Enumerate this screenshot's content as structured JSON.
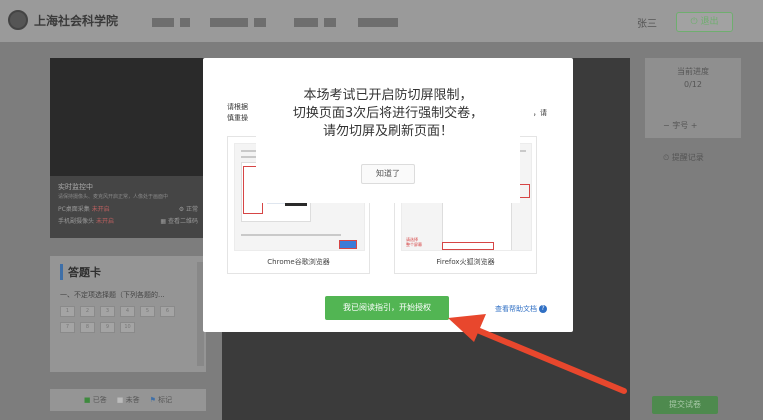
{
  "header": {
    "logo_text": "上海社会科学院",
    "user_name": "张三",
    "logout_label": "退出"
  },
  "monitor": {
    "title": "实时监控中",
    "description": "请保持摄像头、麦克风开启正常，人像处于画面中",
    "pc_label": "PC桌面采集",
    "pc_status": "未开启",
    "pc_status_right": "正常",
    "phone_label": "手机副摄像头",
    "phone_status": "未开启",
    "phone_status_right": "查看二维码"
  },
  "answer_card": {
    "title": "答题卡",
    "section": "一、不定项选择题（下列各题的...",
    "questions": [
      "1",
      "2",
      "3",
      "4",
      "5",
      "6",
      "7",
      "8",
      "9",
      "10"
    ],
    "legend": [
      "已答",
      "未答",
      "标记"
    ]
  },
  "right_panel": {
    "progress_label": "当前进度",
    "progress_value": "0/12",
    "font_size_label": "字号",
    "prompt_record_label": "提醒记录",
    "submit_label": "提交试卷"
  },
  "modal": {
    "intro_line1": "请根据",
    "intro_line2": "慎重操",
    "intro_tail": "，请",
    "browsers": [
      {
        "name": "Chrome谷歌浏览器"
      },
      {
        "name": "Firefox火狐浏览器"
      }
    ],
    "firefox_hint": "请选择\n整个屏幕",
    "main_action_label": "我已阅读指引，开始授权",
    "help_label": "查看帮助文档"
  },
  "alert": {
    "lines": [
      "本场考试已开启防切屏限制，",
      "切换页面3次后将进行强制交卷，",
      "请勿切屏及刷新页面！"
    ],
    "confirm_label": "知道了"
  },
  "colors": {
    "primary_green": "#52b553",
    "link_blue": "#2f6fc4",
    "arrow_red": "#e8472d"
  }
}
